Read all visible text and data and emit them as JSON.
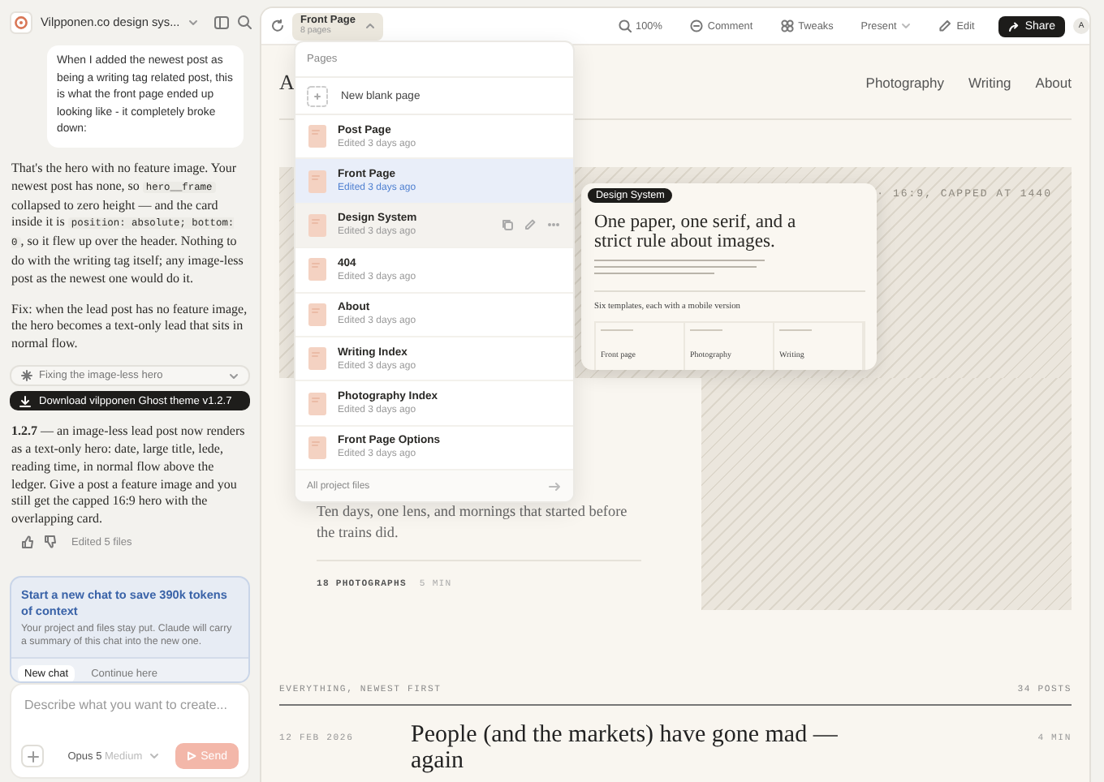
{
  "chat": {
    "title": "Vilpponen.co design sys...",
    "user_message": "When I added the newest post as being a writing tag related post, this is what the front page ended up looking like - it completely broke down:",
    "assistant": [
      {
        "kind": "paragraph",
        "segments": [
          {
            "kind": "text",
            "text": "That's the hero with no feature image. Your newest post has none, so "
          },
          {
            "kind": "code",
            "text": "hero__frame"
          },
          {
            "kind": "text",
            "text": " collapsed to zero height — and the card inside it is "
          },
          {
            "kind": "code",
            "text": "position: absolute; bottom: 0"
          },
          {
            "kind": "text",
            "text": ", so it flew up over the header. Nothing to do with the writing tag itself; any image-less post as the newest one would do it."
          }
        ]
      },
      {
        "kind": "paragraph",
        "segments": [
          {
            "kind": "text",
            "text": "Fix: when the lead post has no feature image, the hero becomes a text-only lead that sits in normal flow."
          }
        ]
      },
      {
        "kind": "step",
        "label": "Fixing the image-less hero"
      },
      {
        "kind": "download",
        "label": "Download vilpponen Ghost theme v1.2.7"
      },
      {
        "kind": "rich",
        "text": "**1.2.7** — an image-less lead post now renders as a text-only hero: date, large title, lede, reading time, in normal flow above the ledger. Give a post a feature image and you still get the capped 16:9 hero with the overlapping card."
      },
      {
        "kind": "feedback",
        "label": "Edited 5 files"
      }
    ],
    "notice": {
      "title": "Start a new chat to save 390k tokens of context",
      "body": "Your project and files stay put. Claude will carry a summary of this chat into the new one.",
      "buttons": [
        "New chat",
        "Continue here"
      ]
    },
    "composer": {
      "placeholder": "Describe what you want to create...",
      "model": "Opus 5",
      "effort": "Medium",
      "send": "Send",
      "send_disabled": true
    }
  },
  "toolbar": {
    "page": "Front Page",
    "page_count": "8 pages",
    "zoom": "100%",
    "actions": [
      {
        "kind": "comment",
        "label": "Comment"
      },
      {
        "kind": "tweaks",
        "label": "Tweaks"
      },
      {
        "kind": "present",
        "label": "Present"
      },
      {
        "kind": "edit",
        "label": "Edit"
      }
    ],
    "share": "Share",
    "avatar": "A"
  },
  "pages_menu": {
    "header": "Pages",
    "new_page": "New blank page",
    "items": [
      {
        "title": "Post Page",
        "subtitle": "Edited 3 days ago",
        "selected": false,
        "hovered": false
      },
      {
        "title": "Front Page",
        "subtitle": "Edited 3 days ago",
        "selected": true,
        "hovered": false
      },
      {
        "title": "Design System",
        "subtitle": "Edited 3 days ago",
        "selected": false,
        "hovered": true
      },
      {
        "title": "404",
        "subtitle": "Edited 3 days ago",
        "selected": false,
        "hovered": false
      },
      {
        "title": "About",
        "subtitle": "Edited 3 days ago",
        "selected": false,
        "hovered": false
      },
      {
        "title": "Writing Index",
        "subtitle": "Edited 3 days ago",
        "selected": false,
        "hovered": false
      },
      {
        "title": "Photography Index",
        "subtitle": "Edited 3 days ago",
        "selected": false,
        "hovered": false
      },
      {
        "title": "Front Page Options",
        "subtitle": "Edited 3 days ago",
        "selected": false,
        "hovered": false
      }
    ],
    "footer": "All project files"
  },
  "preview_card": {
    "tag": "Design System",
    "title": "One paper, one serif, and a strict rule about images.",
    "subtitle": "Six templates, each with a mobile version",
    "columns": [
      "Front page",
      "Photography",
      "Writing"
    ]
  },
  "site": {
    "logo": "A",
    "nav": [
      "Photography",
      "Writing",
      "About"
    ],
    "hero_caption": "· 16:9, CAPPED AT 1440",
    "lede": "Ten days, one lens, and mornings that started before the trains did.",
    "meta": [
      "18 PHOTOGRAPHS",
      "5 MIN"
    ],
    "ledger": {
      "heading": "EVERYTHING, NEWEST FIRST",
      "count": "34 POSTS",
      "rows": [
        {
          "date": "12 FEB 2026",
          "title": "People (and the markets) have gone mad — again",
          "time": "4 MIN"
        }
      ]
    }
  }
}
